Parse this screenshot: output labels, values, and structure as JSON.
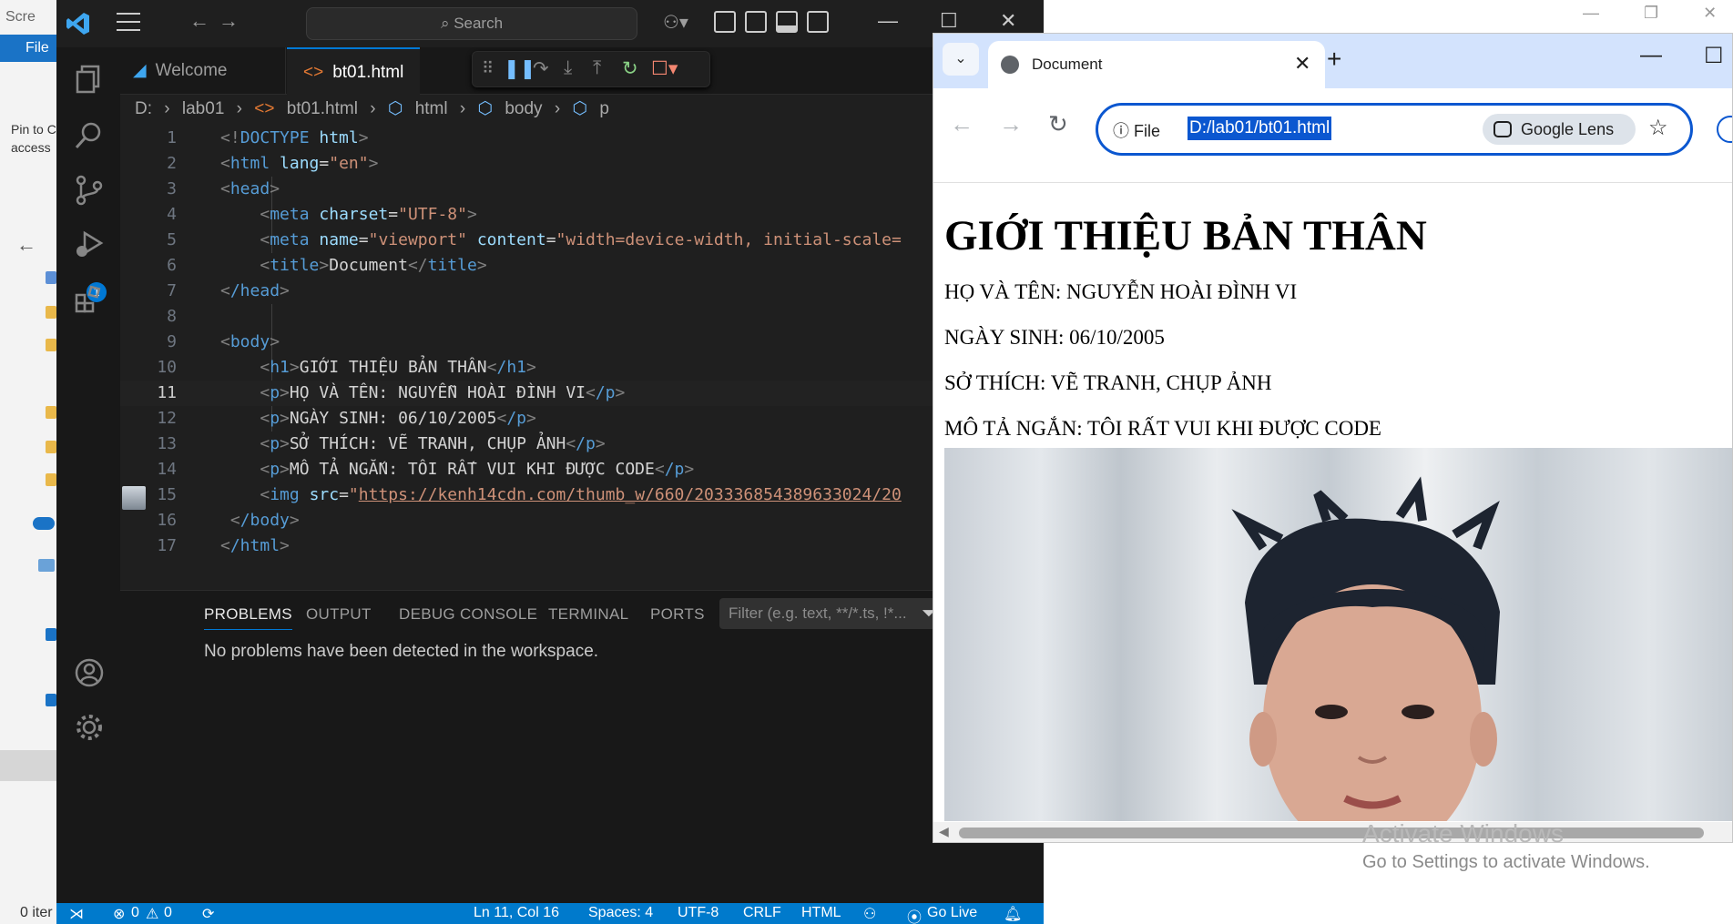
{
  "explorer": {
    "title": "Scre",
    "file_menu": "File",
    "pin_text": "Pin to C\naccess",
    "status_text": "0 iter"
  },
  "vscode": {
    "command_center": "Search",
    "tabs": [
      {
        "label": "Welcome"
      },
      {
        "label": "bt01.html"
      }
    ],
    "breadcrumb": [
      "D:",
      "lab01",
      "bt01.html",
      "html",
      "body",
      "p"
    ],
    "debug_badge": "1",
    "code_lines": [
      {
        "n": "1"
      },
      {
        "n": "2"
      },
      {
        "n": "3"
      },
      {
        "n": "4"
      },
      {
        "n": "5"
      },
      {
        "n": "6"
      },
      {
        "n": "7"
      },
      {
        "n": "8"
      },
      {
        "n": "9"
      },
      {
        "n": "10"
      },
      {
        "n": "11"
      },
      {
        "n": "12"
      },
      {
        "n": "13"
      },
      {
        "n": "14"
      },
      {
        "n": "15"
      },
      {
        "n": "16"
      },
      {
        "n": "17"
      }
    ],
    "code": {
      "l1_a": "<!",
      "l1_b": "DOCTYPE",
      "l1_c": " html",
      "l1_d": ">",
      "l2_tag": "html",
      "l2_attr": "lang",
      "l2_val": "\"en\"",
      "l3_tag": "head",
      "l4_tag": "meta",
      "l4_attr": "charset",
      "l4_val": "\"UTF-8\"",
      "l5_tag": "meta",
      "l5_attr1": "name",
      "l5_val1": "\"viewport\"",
      "l5_attr2": "content",
      "l5_val2": "\"width=device-width, initial-scale=",
      "l6_tag": "title",
      "l6_text": "Document",
      "l7_tag": "/head",
      "l9_tag": "body",
      "l10_tag": "h1",
      "l10_text": "GIỚI THIỆU BẢN THÂN",
      "l10_close": "/h1",
      "l11_tag": "p",
      "l11_text": "HỌ VÀ TÊN: NGUYỄN HOÀI ĐÌNH VI",
      "l11_close": "/p",
      "l12_tag": "p",
      "l12_text": "NGÀY SINH: 06/10/2005",
      "l12_close": "/p",
      "l13_tag": "p",
      "l13_text": "SỞ THÍCH: VẼ TRANH, CHỤP ẢNH",
      "l13_close": "/p",
      "l14_tag": "p",
      "l14_text": "MÔ TẢ NGẮN: TÔI RẤT VUI KHI ĐƯỢC CODE",
      "l14_close": "/p",
      "l15_tag": "img",
      "l15_attr": "src",
      "l15_url": "https://kenh14cdn.com/thumb_w/660/203336854389633024/20",
      "l16_tag": "/body",
      "l17_tag": "/html"
    },
    "panel": {
      "tabs": [
        "PROBLEMS",
        "OUTPUT",
        "DEBUG CONSOLE",
        "TERMINAL",
        "PORTS"
      ],
      "filter_placeholder": "Filter (e.g. text, **/*.ts, !*...",
      "message": "No problems have been detected in the workspace."
    },
    "status": {
      "errors": "0",
      "warnings": "0",
      "position": "Ln 11, Col 16",
      "spaces": "Spaces: 4",
      "encoding": "UTF-8",
      "eol": "CRLF",
      "language": "HTML",
      "golive": "Go Live"
    },
    "colors": {
      "accent": "#0078d4",
      "statusbar": "#007acc"
    }
  },
  "chrome": {
    "tab_title": "Document",
    "scheme_label": "File",
    "address": "D:/lab01/bt01.html",
    "lens_label": "Google Lens",
    "page": {
      "h1": "GIỚI THIỆU BẢN THÂN",
      "p1": "HỌ VÀ TÊN: NGUYỄN HOÀI ĐÌNH VI",
      "p2": "NGÀY SINH: 06/10/2005",
      "p3": "SỞ THÍCH: VẼ TRANH, CHỤP ẢNH",
      "p4": "MÔ TẢ NGẮN: TÔI RẤT VUI KHI ĐƯỢC CODE"
    }
  },
  "watermark": {
    "line1": "Activate Windows",
    "line2": "Go to Settings to activate Windows."
  }
}
